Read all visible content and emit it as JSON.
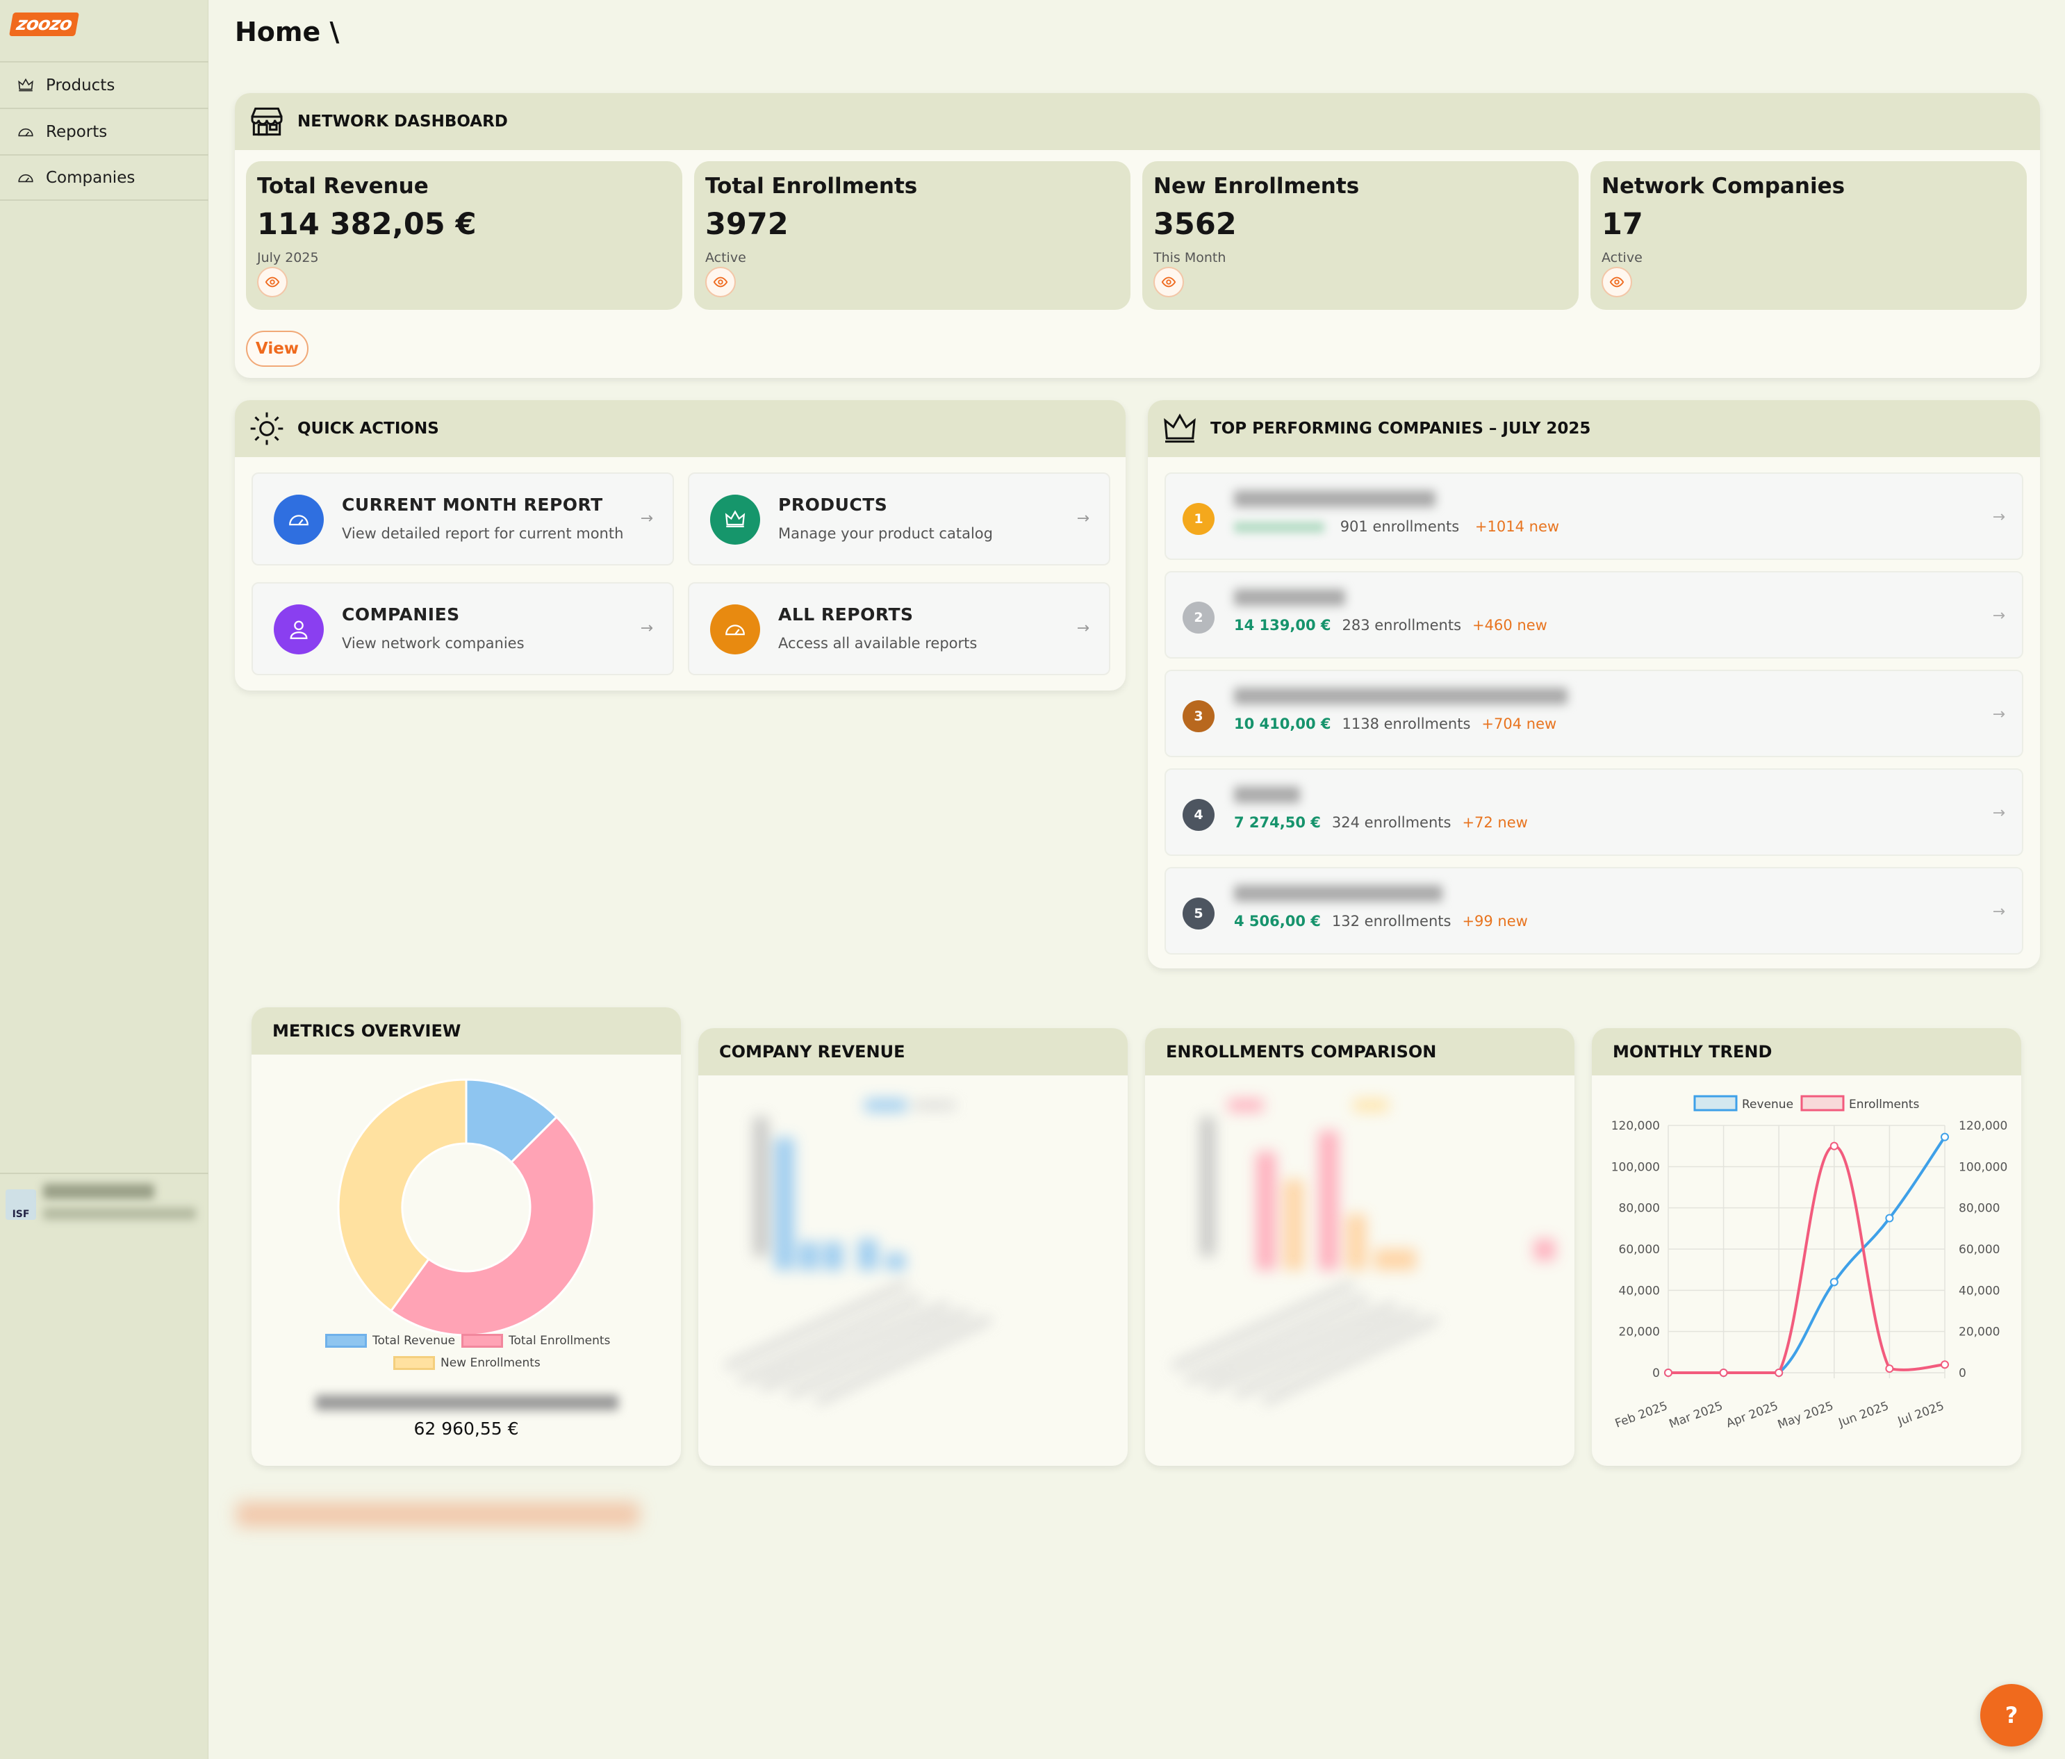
{
  "app": {
    "logo_text": "zoozo"
  },
  "sidebar": {
    "items": [
      {
        "label": "Products",
        "icon": "crown-icon"
      },
      {
        "label": "Reports",
        "icon": "gauge-icon"
      },
      {
        "label": "Companies",
        "icon": "gauge-icon"
      }
    ],
    "user": {
      "avatar_text": "ISF"
    }
  },
  "header": {
    "title": "Home \\"
  },
  "network": {
    "title": "NETWORK DASHBOARD",
    "stats": [
      {
        "label": "Total Revenue",
        "value": "114 382,05 €",
        "sub": "July 2025"
      },
      {
        "label": "Total Enrollments",
        "value": "3972",
        "sub": "Active"
      },
      {
        "label": "New Enrollments",
        "value": "3562",
        "sub": "This Month"
      },
      {
        "label": "Network Companies",
        "value": "17",
        "sub": "Active"
      }
    ],
    "view_label": "View"
  },
  "quick_actions": {
    "title": "QUICK ACTIONS",
    "items": [
      {
        "title": "CURRENT MONTH REPORT",
        "desc": "View detailed report for current month",
        "icon": "gauge-icon",
        "color": "#2f6fe0"
      },
      {
        "title": "PRODUCTS",
        "desc": "Manage your product catalog",
        "icon": "crown-icon",
        "color": "#16966b"
      },
      {
        "title": "COMPANIES",
        "desc": "View network companies",
        "icon": "user-icon",
        "color": "#8a3ff0"
      },
      {
        "title": "ALL REPORTS",
        "desc": "Access all available reports",
        "icon": "gauge-icon",
        "color": "#e88a10"
      }
    ],
    "arrow": "→"
  },
  "top_companies": {
    "title": "TOP PERFORMING COMPANIES – JULY 2025",
    "rows": [
      {
        "rank": "1",
        "revenue": "",
        "enrollments": "901 enrollments",
        "new": "+1014 new",
        "color": "#f4a81c"
      },
      {
        "rank": "2",
        "revenue": "14 139,00 €",
        "enrollments": "283 enrollments",
        "new": "+460 new",
        "color": "#b6b9bd"
      },
      {
        "rank": "3",
        "revenue": "10 410,00 €",
        "enrollments": "1138 enrollments",
        "new": "+704 new",
        "color": "#b8681e"
      },
      {
        "rank": "4",
        "revenue": "7 274,50 €",
        "enrollments": "324 enrollments",
        "new": "+72 new",
        "color": "#4d5560"
      },
      {
        "rank": "5",
        "revenue": "4 506,00 €",
        "enrollments": "132 enrollments",
        "new": "+99 new",
        "color": "#4d5560"
      }
    ]
  },
  "metrics": {
    "title": "METRICS OVERVIEW",
    "legend": [
      "Total Revenue",
      "Total Enrollments",
      "New Enrollments"
    ],
    "total": "62 960,55 €"
  },
  "company_revenue": {
    "title": "COMPANY REVENUE"
  },
  "enrollments_comparison": {
    "title": "ENROLLMENTS COMPARISON"
  },
  "monthly_trend": {
    "title": "MONTHLY TREND",
    "legend": [
      "Revenue",
      "Enrollments"
    ],
    "y_ticks": [
      "120,000",
      "100,000",
      "80,000",
      "60,000",
      "40,000",
      "20,000",
      "0"
    ]
  },
  "chart_data": [
    {
      "type": "pie",
      "title": "METRICS OVERVIEW",
      "categories": [
        "Total Revenue",
        "Total Enrollments",
        "New Enrollments"
      ],
      "values": [
        12.5,
        47.5,
        40.0
      ],
      "colors": [
        "#8ec5f0",
        "#ffa3b5",
        "#ffe1a0"
      ],
      "donut": true,
      "legend": "bottom"
    },
    {
      "type": "line",
      "title": "MONTHLY TREND",
      "categories": [
        "Feb 2025",
        "Mar 2025",
        "Apr 2025",
        "May 2025",
        "Jun 2025",
        "Jul 2025"
      ],
      "series": [
        {
          "name": "Revenue",
          "values": [
            0,
            0,
            0,
            44000,
            75000,
            114382
          ],
          "color": "#3ea0e8"
        },
        {
          "name": "Enrollments",
          "values": [
            0,
            0,
            0,
            110000,
            2000,
            3972
          ],
          "color": "#f25b7d"
        }
      ],
      "ylim": [
        0,
        120000
      ],
      "legend": "top",
      "grid": true
    }
  ]
}
